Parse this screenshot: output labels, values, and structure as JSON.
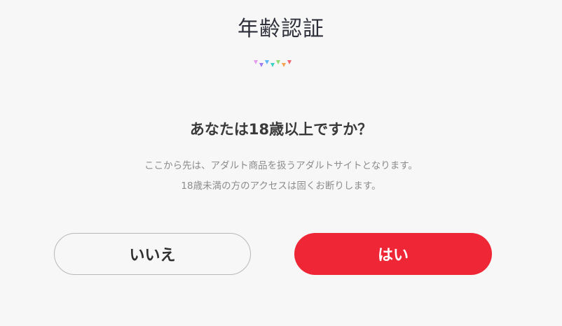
{
  "header": {
    "title": "年齢認証",
    "decoration_icon": "bunting-icon",
    "bunting_colors": [
      "#e79bf0",
      "#9d7cf4",
      "#5ab8f5",
      "#3fd1c4",
      "#8fdc72",
      "#f5a552",
      "#f0646e"
    ]
  },
  "prompt": {
    "question": "あなたは18歳以上ですか？",
    "note_line1": "ここから先は、アダルト商品を扱うアダルトサイトとなります。",
    "note_line2": "18歳未満の方のアクセスは固くお断りします。"
  },
  "actions": {
    "no_label": "いいえ",
    "yes_label": "はい"
  },
  "colors": {
    "accent": "#ee2636",
    "background": "#f7f7f7"
  }
}
